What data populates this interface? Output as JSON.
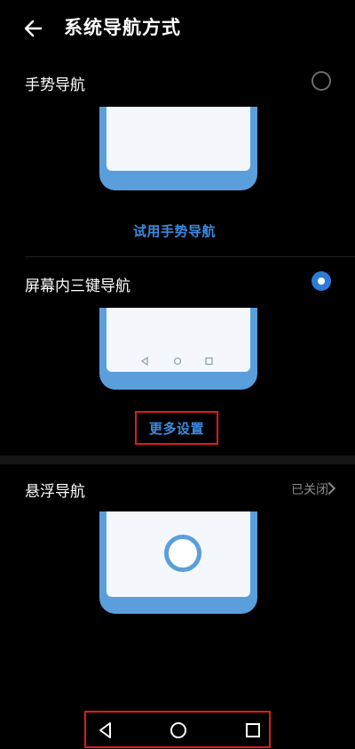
{
  "header": {
    "title": "系统导航方式"
  },
  "gesture": {
    "label": "手势导航",
    "selected": false,
    "try_label": "试用手势导航"
  },
  "three_key": {
    "label": "屏幕内三键导航",
    "selected": true,
    "more_label": "更多设置"
  },
  "floating": {
    "label": "悬浮导航",
    "status": "已关闭"
  },
  "icons": [
    "back-arrow-icon",
    "nav-back-icon",
    "nav-home-icon",
    "nav-recents-icon",
    "chevron-right-icon"
  ],
  "colors": {
    "accent": "#3d8be0",
    "radio_selected": "#2e7bd6",
    "highlight_border": "#e0191b",
    "phone_frame": "#5a9fdb"
  }
}
